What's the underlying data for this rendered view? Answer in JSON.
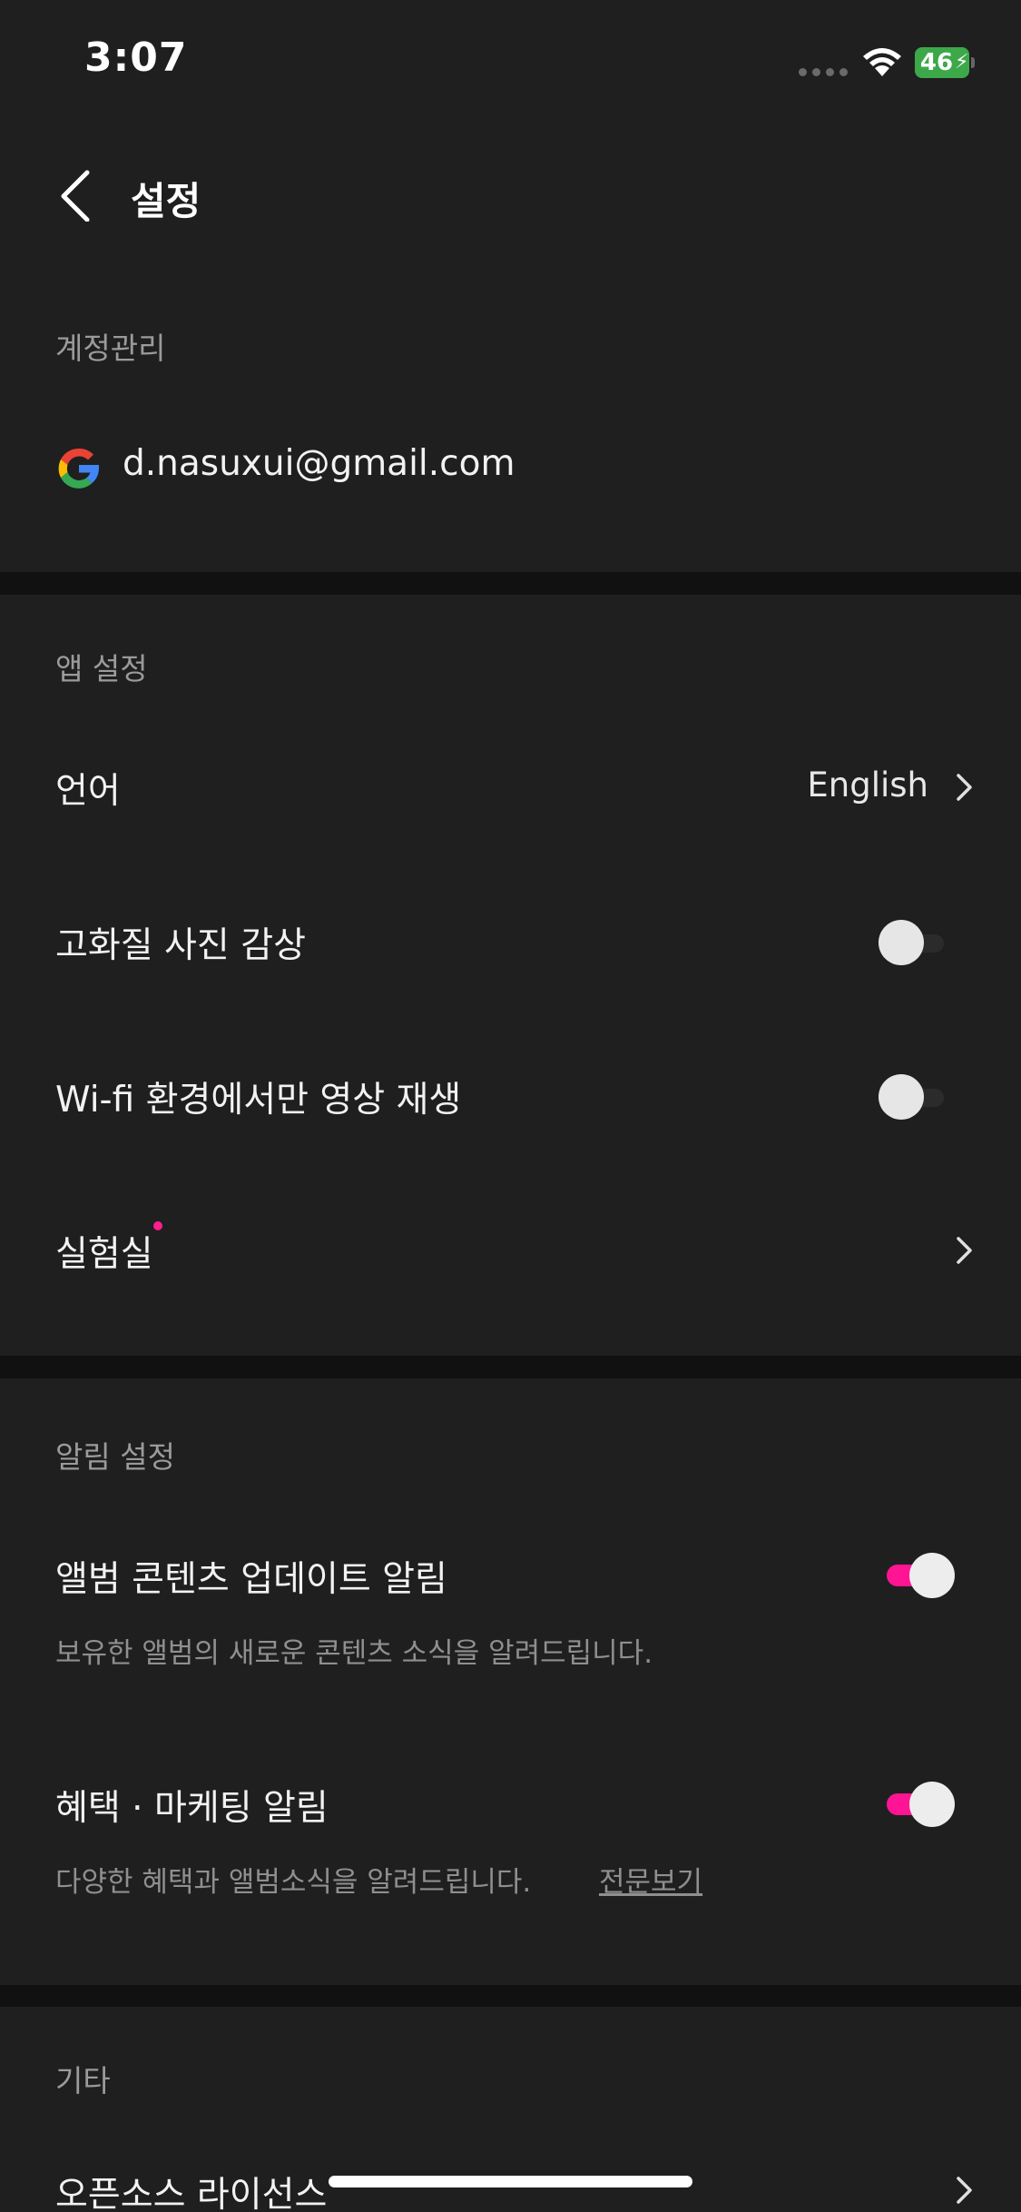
{
  "status_bar": {
    "time": "3:07",
    "battery": "46"
  },
  "nav": {
    "title": "설정"
  },
  "account": {
    "header": "계정관리",
    "email": "d.nasuxui@gmail.com"
  },
  "app_settings": {
    "header": "앱 설정",
    "language_label": "언어",
    "language_value": "English",
    "hq_photo_label": "고화질 사진 감상",
    "hq_photo_on": false,
    "wifi_video_label": "Wi-fi 환경에서만 영상 재생",
    "wifi_video_on": false,
    "lab_label": "실험실"
  },
  "notification_settings": {
    "header": "알림 설정",
    "album_update_label": "앨범 콘텐츠 업데이트 알림",
    "album_update_desc": "보유한 앨범의 새로운 콘텐츠 소식을 알려드립니다.",
    "album_update_on": true,
    "marketing_label": "혜택 · 마케팅 알림",
    "marketing_desc": "다양한 혜택과 앨범소식을 알려드립니다.",
    "marketing_link": "전문보기",
    "marketing_on": true
  },
  "other": {
    "header": "기타",
    "license_label": "오픈소스 라이선스"
  },
  "colors": {
    "accent": "#ff1493",
    "background": "#1f1f1f",
    "divider": "#111111"
  }
}
